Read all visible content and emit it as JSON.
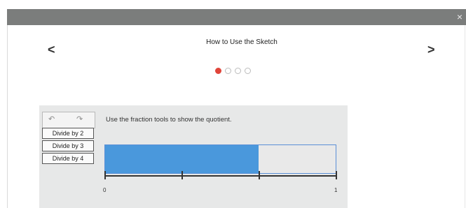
{
  "window": {
    "close_glyph": "×"
  },
  "nav": {
    "prev_glyph": "<",
    "next_glyph": ">"
  },
  "header": {
    "title": "How to Use the Sketch"
  },
  "pagination": {
    "total": 4,
    "active_index": 0,
    "active_color": "#e0453a"
  },
  "tools": {
    "undo_glyph": "↶",
    "redo_glyph": "↷",
    "buttons": [
      "Divide by 2",
      "Divide by 3",
      "Divide by 4"
    ]
  },
  "sketch": {
    "instruction": "Use the fraction tools to show the quotient.",
    "filled_fraction": 0.667,
    "fill_color": "#4a98dc",
    "number_line": {
      "start_label": "0",
      "end_label": "1",
      "tick_count": 4
    }
  }
}
